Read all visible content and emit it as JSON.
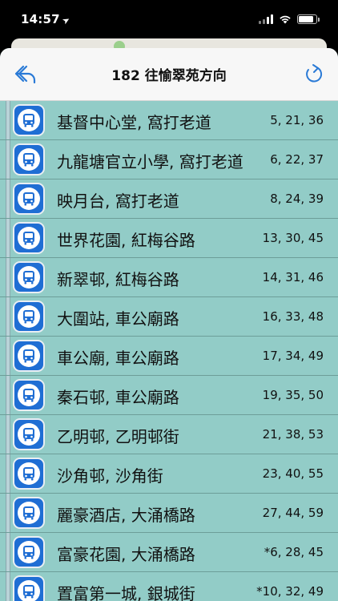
{
  "status": {
    "time": "14:57"
  },
  "header": {
    "title": "182 往愉翠苑方向",
    "back_icon": "back-arrow-icon",
    "refresh_icon": "refresh-icon"
  },
  "colors": {
    "sheet_background": "#92ccc7",
    "stop_icon": "#1f6ed4",
    "header_icon": "#2a7ad6"
  },
  "stops": [
    {
      "name": "基督中心堂, 窩打老道",
      "times": "5, 21, 36"
    },
    {
      "name": "九龍塘官立小學, 窩打老道",
      "times": "6, 22, 37"
    },
    {
      "name": "映月台, 窩打老道",
      "times": "8, 24, 39"
    },
    {
      "name": "世界花園, 紅梅谷路",
      "times": "13, 30, 45"
    },
    {
      "name": "新翠邨, 紅梅谷路",
      "times": "14, 31, 46"
    },
    {
      "name": "大圍站, 車公廟路",
      "times": "16, 33, 48"
    },
    {
      "name": "車公廟, 車公廟路",
      "times": "17, 34, 49"
    },
    {
      "name": "秦石邨, 車公廟路",
      "times": "19, 35, 50"
    },
    {
      "name": "乙明邨,  乙明邨街",
      "times": "21, 38, 53"
    },
    {
      "name": "沙角邨, 沙角街",
      "times": "23, 40, 55"
    },
    {
      "name": "麗豪酒店, 大涌橋路",
      "times": "27, 44, 59"
    },
    {
      "name": "富豪花園, 大涌橋路",
      "times": "*6, 28, 45"
    },
    {
      "name": "置富第一城, 銀城街",
      "times": "*10, 32, 49"
    }
  ]
}
